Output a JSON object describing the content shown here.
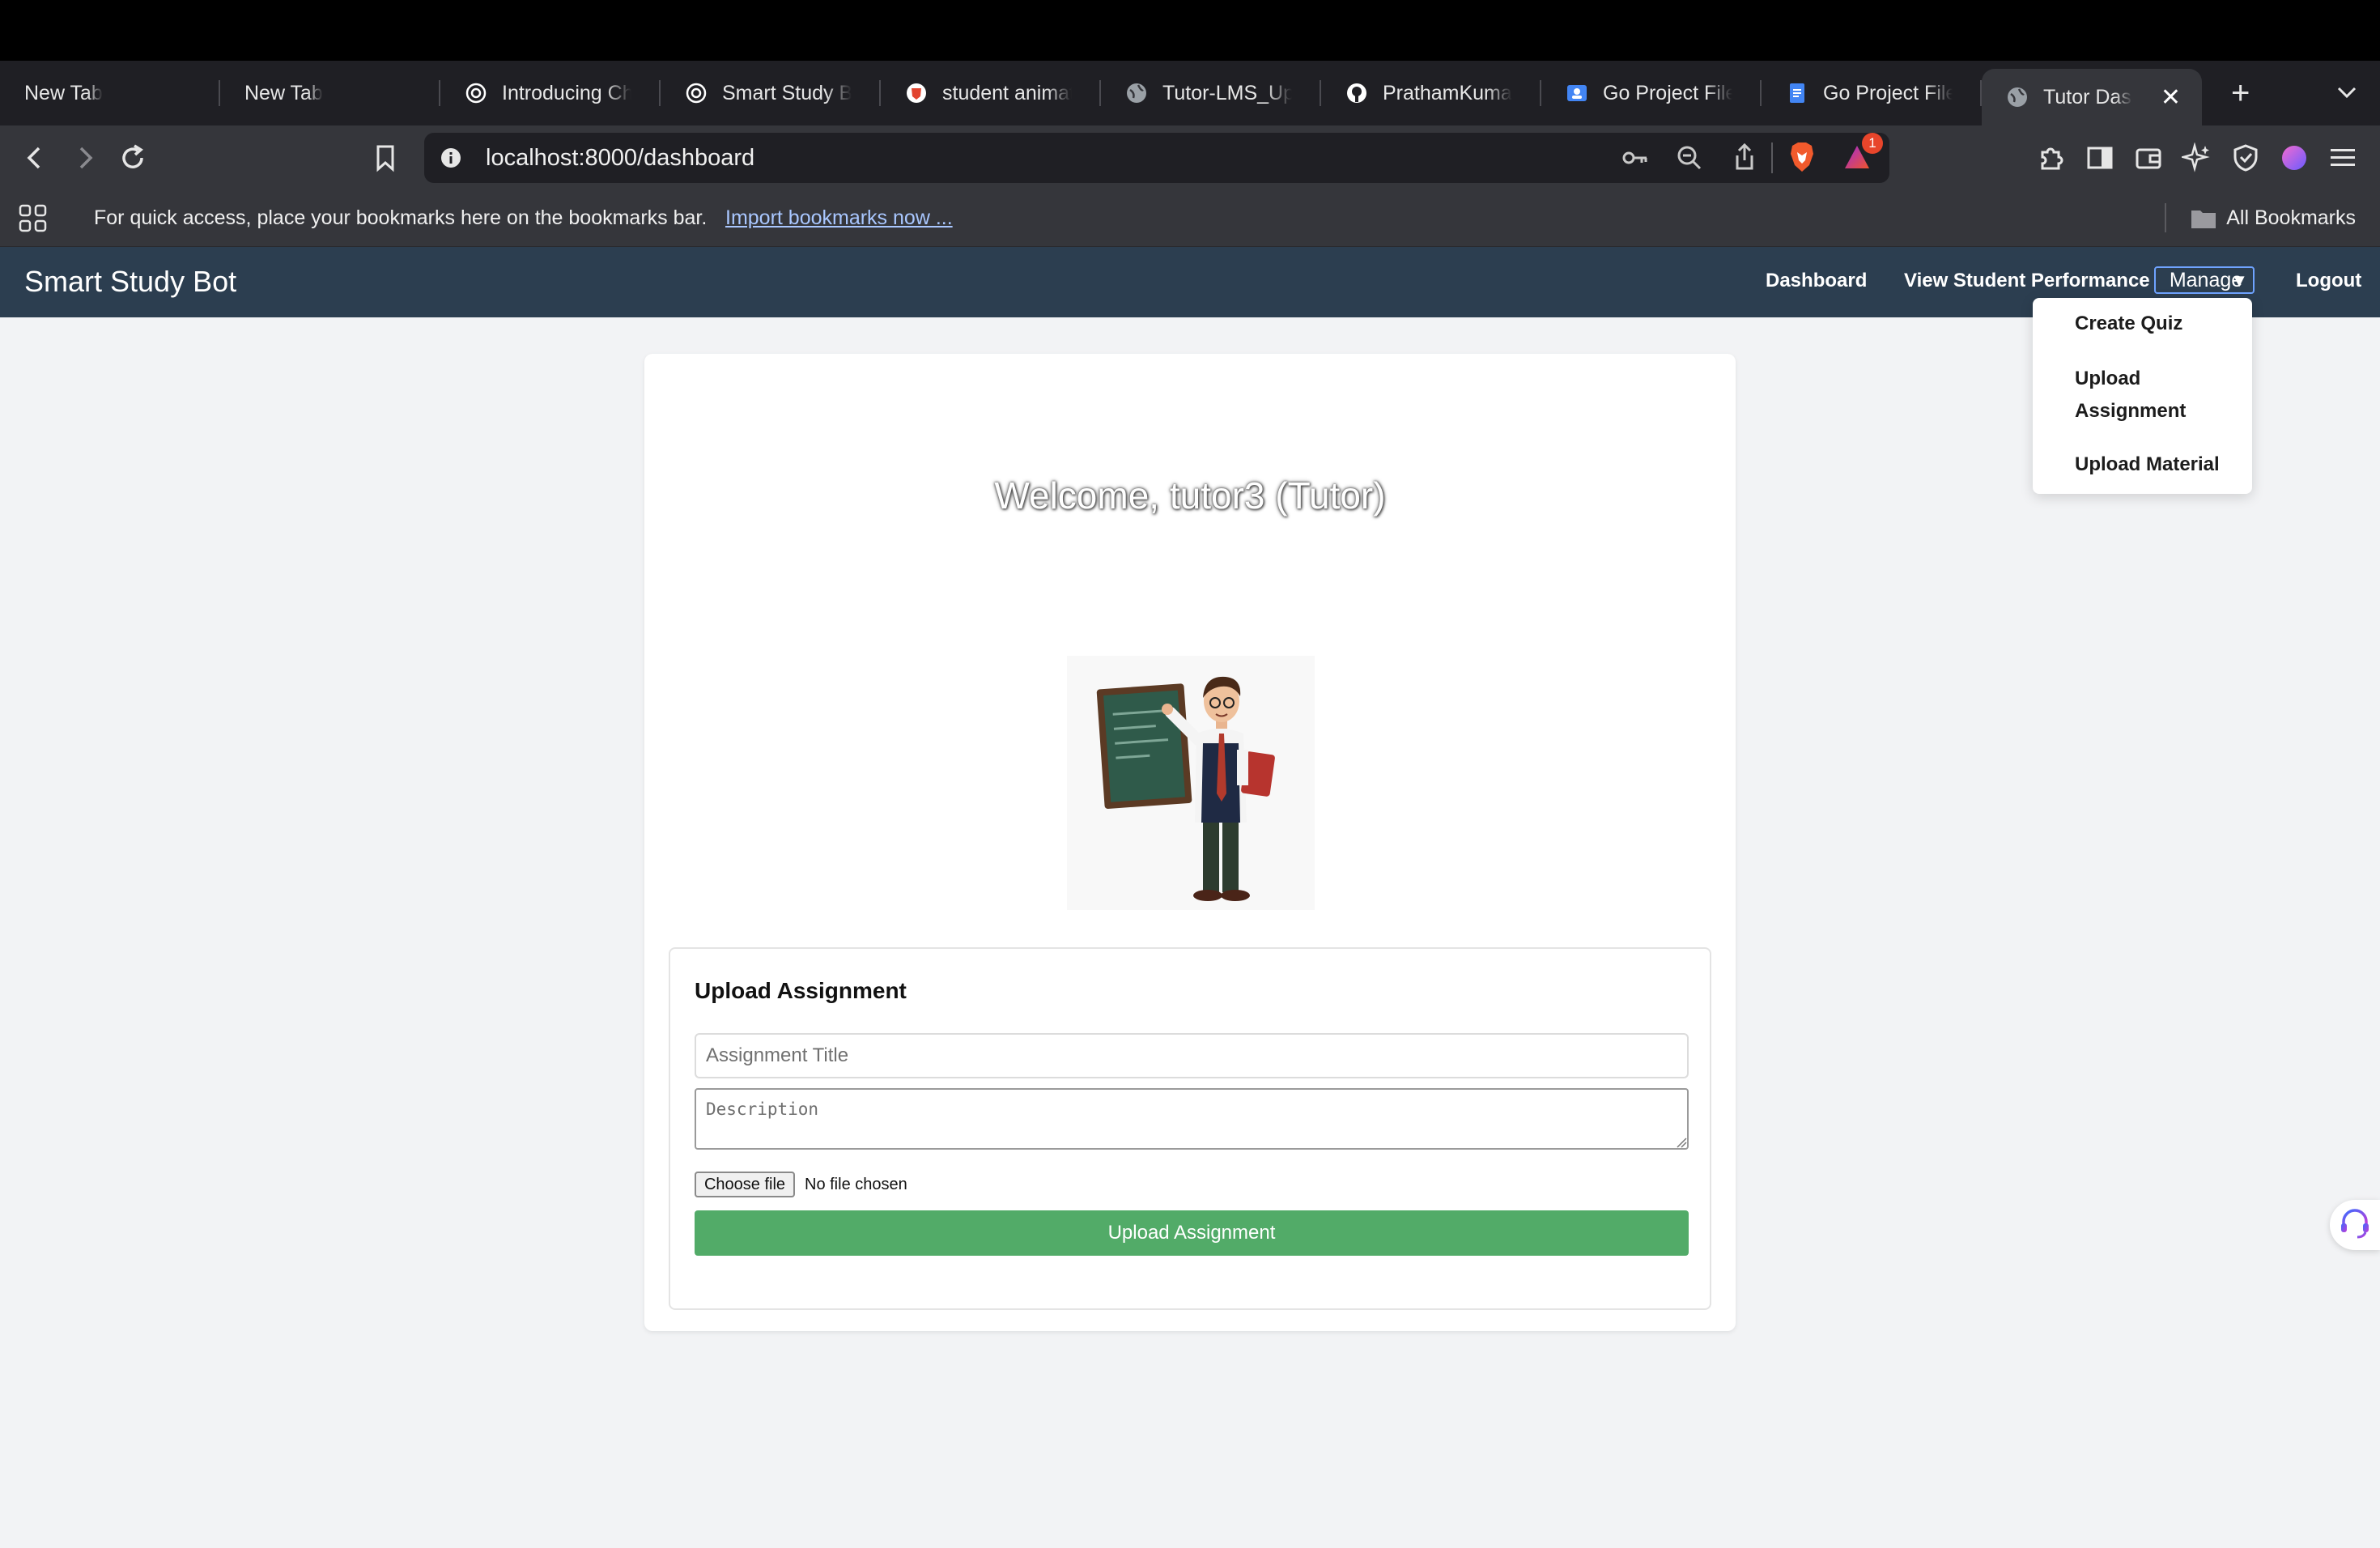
{
  "browser": {
    "tabs": [
      {
        "title": "New Tab",
        "favicon": "none"
      },
      {
        "title": "New Tab",
        "favicon": "none"
      },
      {
        "title": "Introducing ChatGPT",
        "favicon": "openai-icon"
      },
      {
        "title": "Smart Study Bot",
        "favicon": "openai-icon"
      },
      {
        "title": "student animation",
        "favicon": "brave-search-icon"
      },
      {
        "title": "Tutor-LMS_Upd",
        "favicon": "globe-icon"
      },
      {
        "title": "PrathamKumar",
        "favicon": "github-icon"
      },
      {
        "title": "Go Project File",
        "favicon": "google-classroom-icon"
      },
      {
        "title": "Go Project File",
        "favicon": "google-docs-icon"
      },
      {
        "title": "Tutor Dashboard",
        "favicon": "globe-icon",
        "active": true
      }
    ],
    "url": "localhost:8000/dashboard",
    "rewards_badge": "1",
    "bookmarks_bar": {
      "message": "For quick access, place your bookmarks here on the bookmarks bar.",
      "import_link": "Import bookmarks now ...",
      "all_bookmarks": "All Bookmarks"
    },
    "colors": {
      "chrome_dark": "#1f1f24",
      "toolbar": "#35363b"
    }
  },
  "app": {
    "brand": "Smart Study Bot",
    "nav": {
      "dashboard": "Dashboard",
      "performance": "View Student Performance",
      "manage": "Manage",
      "logout": "Logout"
    },
    "manage_menu": {
      "create_quiz": "Create Quiz",
      "upload_assignment_line1": "Upload",
      "upload_assignment_line2": "Assignment",
      "upload_material": "Upload Material"
    },
    "welcome": "Welcome, tutor3 (Tutor)",
    "form": {
      "heading": "Upload Assignment",
      "title_placeholder": "Assignment Title",
      "description_placeholder": "Description",
      "choose_file": "Choose file",
      "no_file": "No file chosen",
      "submit": "Upload Assignment"
    },
    "colors": {
      "navbar": "#2c3e50",
      "primary_button": "#52ab68",
      "background": "#f2f3f5"
    }
  }
}
